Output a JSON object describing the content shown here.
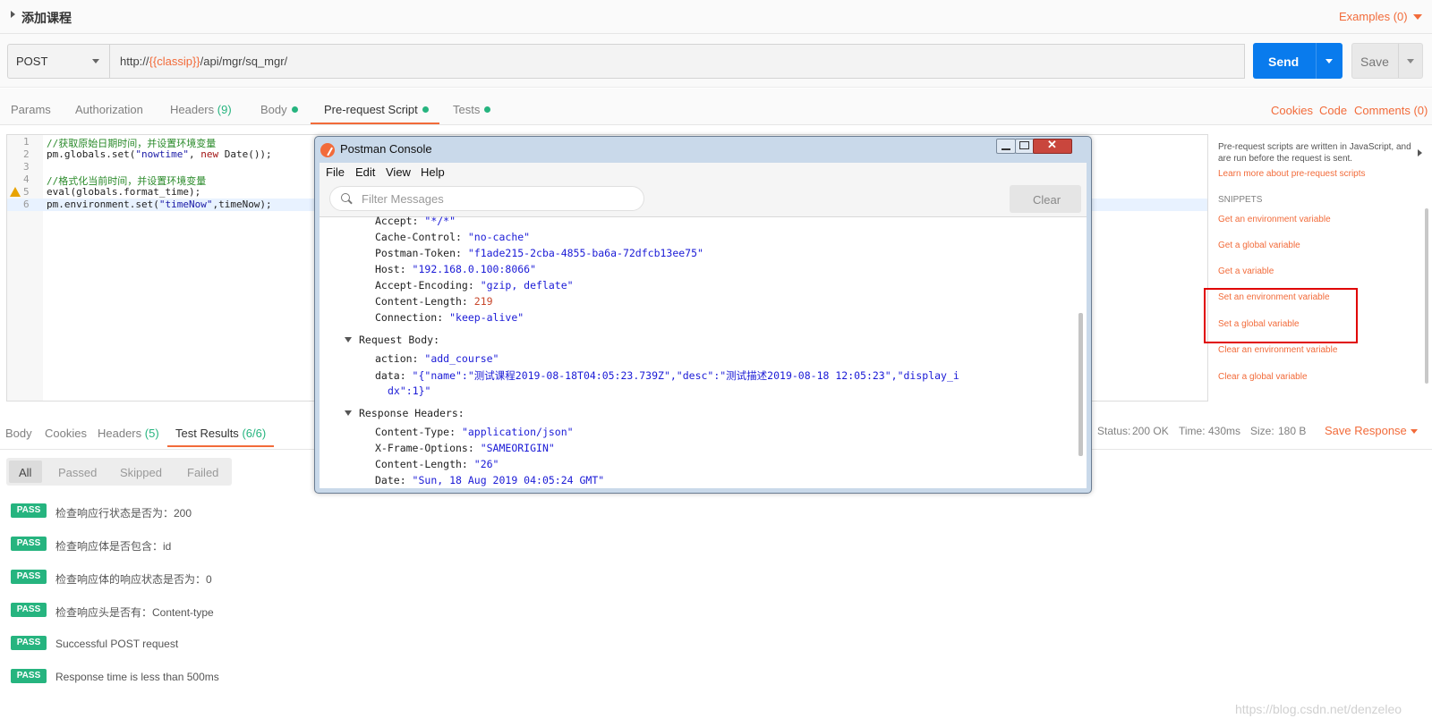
{
  "title_bar": {
    "title": "添加课程",
    "examples": "Examples (0)"
  },
  "request": {
    "method": "POST",
    "url_prefix": "http://",
    "url_var": "{{classip}}",
    "url_suffix": "/api/mgr/sq_mgr/",
    "send_label": "Send",
    "save_label": "Save"
  },
  "tabs": {
    "params": "Params",
    "authorization": "Authorization",
    "headers": "Headers",
    "headers_count": "(9)",
    "body": "Body",
    "prerequest": "Pre-request Script",
    "tests": "Tests",
    "cookies": "Cookies",
    "code": "Code",
    "comments": "Comments (0)"
  },
  "editor": {
    "lines": [
      "1",
      "2",
      "3",
      "4",
      "5",
      "6"
    ],
    "line1": "//获取原始日期时间，并设置环境变量",
    "line2_a": "pm.globals.set(",
    "line2_b": "\"nowtime\"",
    "line2_c": ", ",
    "line2_d": "new",
    "line2_e": " Date());",
    "line4": "//格式化当前时间，并设置环境变量",
    "line5": "eval(globals.format_time);",
    "line6_a": "pm.environment.set(",
    "line6_b": "\"timeNow\"",
    "line6_c": ",timeNow);"
  },
  "snippets": {
    "description": "Pre-request scripts are written in JavaScript, and are run before the request is sent.",
    "learn_more": "Learn more about pre-request scripts",
    "heading": "SNIPPETS",
    "items": [
      "Get an environment variable",
      "Get a global variable",
      "Get a variable",
      "Set an environment variable",
      "Set a global variable",
      "Clear an environment variable",
      "Clear a global variable"
    ]
  },
  "response": {
    "tabs": {
      "body": "Body",
      "cookies": "Cookies",
      "headers": "Headers",
      "headers_count": "(5)",
      "test_results": "Test Results",
      "test_count": "(6/6)"
    },
    "status_label": "Status:",
    "status_value": "200 OK",
    "time_label": "Time:",
    "time_value": "430ms",
    "size_label": "Size:",
    "size_value": "180 B",
    "save_response": "Save Response",
    "filters": [
      "All",
      "Passed",
      "Skipped",
      "Failed"
    ],
    "pass_label": "PASS",
    "results": [
      "检查响应行状态是否为：200",
      "检查响应体是否包含：id",
      "检查响应体的响应状态是否为：0",
      "检查响应头是否有：Content-type",
      "Successful POST request",
      "Response time is less than 500ms"
    ]
  },
  "console": {
    "title": "Postman Console",
    "menu": [
      "File",
      "Edit",
      "View",
      "Help"
    ],
    "filter_placeholder": "Filter Messages",
    "clear_label": "Clear",
    "headers": [
      {
        "key": "Accept: ",
        "value": "\"*/*\""
      },
      {
        "key": "Cache-Control: ",
        "value": "\"no-cache\""
      },
      {
        "key": "Postman-Token: ",
        "value": "\"f1ade215-2cba-4855-ba6a-72dfcb13ee75\""
      },
      {
        "key": "Host: ",
        "value": "\"192.168.0.100:8066\""
      },
      {
        "key": "Accept-Encoding: ",
        "value": "\"gzip, deflate\""
      },
      {
        "key": "Content-Length: ",
        "value": "219"
      },
      {
        "key": "Connection: ",
        "value": "\"keep-alive\""
      }
    ],
    "request_body_label": "Request Body:",
    "action_key": "action: ",
    "action_value": "\"add_course\"",
    "data_key": "data: ",
    "data_value_1": "\"{\"name\":\"测试课程2019-08-18T04:05:23.739Z\",\"desc\":\"测试描述2019-08-18 12:05:23\",\"display_i",
    "data_value_2": "dx\":1}\"",
    "response_headers_label": "Response Headers:",
    "resp_headers": [
      {
        "key": "Content-Type: ",
        "value": "\"application/json\""
      },
      {
        "key": "X-Frame-Options: ",
        "value": "\"SAMEORIGIN\""
      },
      {
        "key": "Content-Length: ",
        "value": "\"26\""
      },
      {
        "key": "Date: ",
        "value": "\"Sun, 18 Aug 2019 04:05:24 GMT\""
      }
    ]
  },
  "watermark": "https://blog.csdn.net/denzeleo"
}
